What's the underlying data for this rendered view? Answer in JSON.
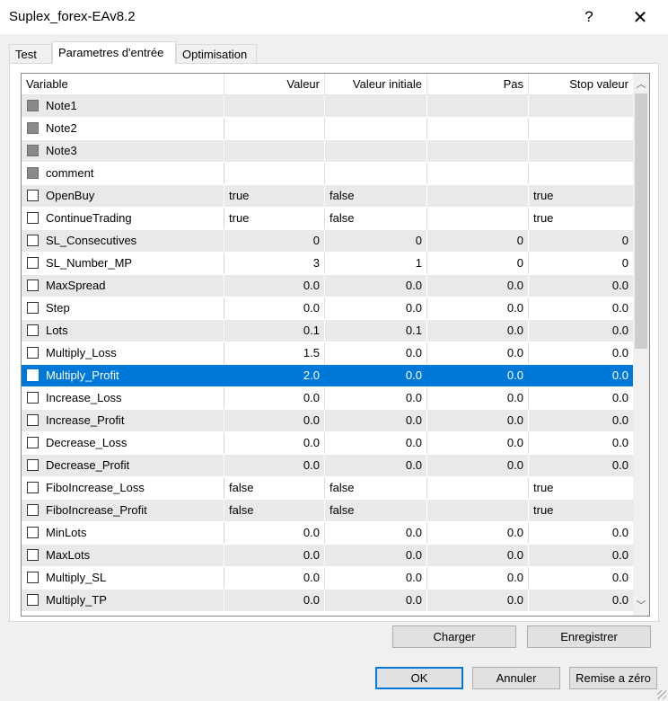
{
  "window": {
    "title": "Suplex_forex-EAv8.2",
    "help_glyph": "?",
    "close_glyph": "✕"
  },
  "tabs": [
    {
      "label": "Test",
      "active": false
    },
    {
      "label": "Parametres d'entrée",
      "active": true
    },
    {
      "label": "Optimisation",
      "active": false
    }
  ],
  "table": {
    "columns": [
      "Variable",
      "Valeur",
      "Valeur initiale",
      "Pas",
      "Stop valeur"
    ],
    "rows": [
      {
        "name": "Note1",
        "disabled": true,
        "value": "",
        "initial": "",
        "step": "",
        "stop": ""
      },
      {
        "name": "Note2",
        "disabled": true,
        "value": "",
        "initial": "",
        "step": "",
        "stop": ""
      },
      {
        "name": "Note3",
        "disabled": true,
        "value": "",
        "initial": "",
        "step": "",
        "stop": ""
      },
      {
        "name": "comment",
        "disabled": true,
        "value": "",
        "initial": "",
        "step": "",
        "stop": ""
      },
      {
        "name": "OpenBuy",
        "disabled": false,
        "value": "true",
        "initial": "false",
        "step": "",
        "stop": "true",
        "text": true
      },
      {
        "name": "ContinueTrading",
        "disabled": false,
        "value": "true",
        "initial": "false",
        "step": "",
        "stop": "true",
        "text": true
      },
      {
        "name": "SL_Consecutives",
        "disabled": false,
        "value": "0",
        "initial": "0",
        "step": "0",
        "stop": "0"
      },
      {
        "name": "SL_Number_MP",
        "disabled": false,
        "value": "3",
        "initial": "1",
        "step": "0",
        "stop": "0"
      },
      {
        "name": "MaxSpread",
        "disabled": false,
        "value": "0.0",
        "initial": "0.0",
        "step": "0.0",
        "stop": "0.0"
      },
      {
        "name": "Step",
        "disabled": false,
        "value": "0.0",
        "initial": "0.0",
        "step": "0.0",
        "stop": "0.0"
      },
      {
        "name": "Lots",
        "disabled": false,
        "value": "0.1",
        "initial": "0.1",
        "step": "0.0",
        "stop": "0.0"
      },
      {
        "name": "Multiply_Loss",
        "disabled": false,
        "value": "1.5",
        "initial": "0.0",
        "step": "0.0",
        "stop": "0.0"
      },
      {
        "name": "Multiply_Profit",
        "disabled": false,
        "value": "2.0",
        "initial": "0.0",
        "step": "0.0",
        "stop": "0.0",
        "selected": true
      },
      {
        "name": "Increase_Loss",
        "disabled": false,
        "value": "0.0",
        "initial": "0.0",
        "step": "0.0",
        "stop": "0.0"
      },
      {
        "name": "Increase_Profit",
        "disabled": false,
        "value": "0.0",
        "initial": "0.0",
        "step": "0.0",
        "stop": "0.0"
      },
      {
        "name": "Decrease_Loss",
        "disabled": false,
        "value": "0.0",
        "initial": "0.0",
        "step": "0.0",
        "stop": "0.0"
      },
      {
        "name": "Decrease_Profit",
        "disabled": false,
        "value": "0.0",
        "initial": "0.0",
        "step": "0.0",
        "stop": "0.0"
      },
      {
        "name": "FiboIncrease_Loss",
        "disabled": false,
        "value": "false",
        "initial": "false",
        "step": "",
        "stop": "true",
        "text": true
      },
      {
        "name": "FiboIncrease_Profit",
        "disabled": false,
        "value": "false",
        "initial": "false",
        "step": "",
        "stop": "true",
        "text": true
      },
      {
        "name": "MinLots",
        "disabled": false,
        "value": "0.0",
        "initial": "0.0",
        "step": "0.0",
        "stop": "0.0"
      },
      {
        "name": "MaxLots",
        "disabled": false,
        "value": "0.0",
        "initial": "0.0",
        "step": "0.0",
        "stop": "0.0"
      },
      {
        "name": "Multiply_SL",
        "disabled": false,
        "value": "0.0",
        "initial": "0.0",
        "step": "0.0",
        "stop": "0.0"
      },
      {
        "name": "Multiply_TP",
        "disabled": false,
        "value": "0.0",
        "initial": "0.0",
        "step": "0.0",
        "stop": "0.0"
      }
    ]
  },
  "scrollbar": {
    "up_glyph": "︿",
    "down_glyph": "﹀"
  },
  "buttons": {
    "charger": "Charger",
    "enregistrer": "Enregistrer",
    "ok": "OK",
    "annuler": "Annuler",
    "remise": "Remise a zéro"
  }
}
